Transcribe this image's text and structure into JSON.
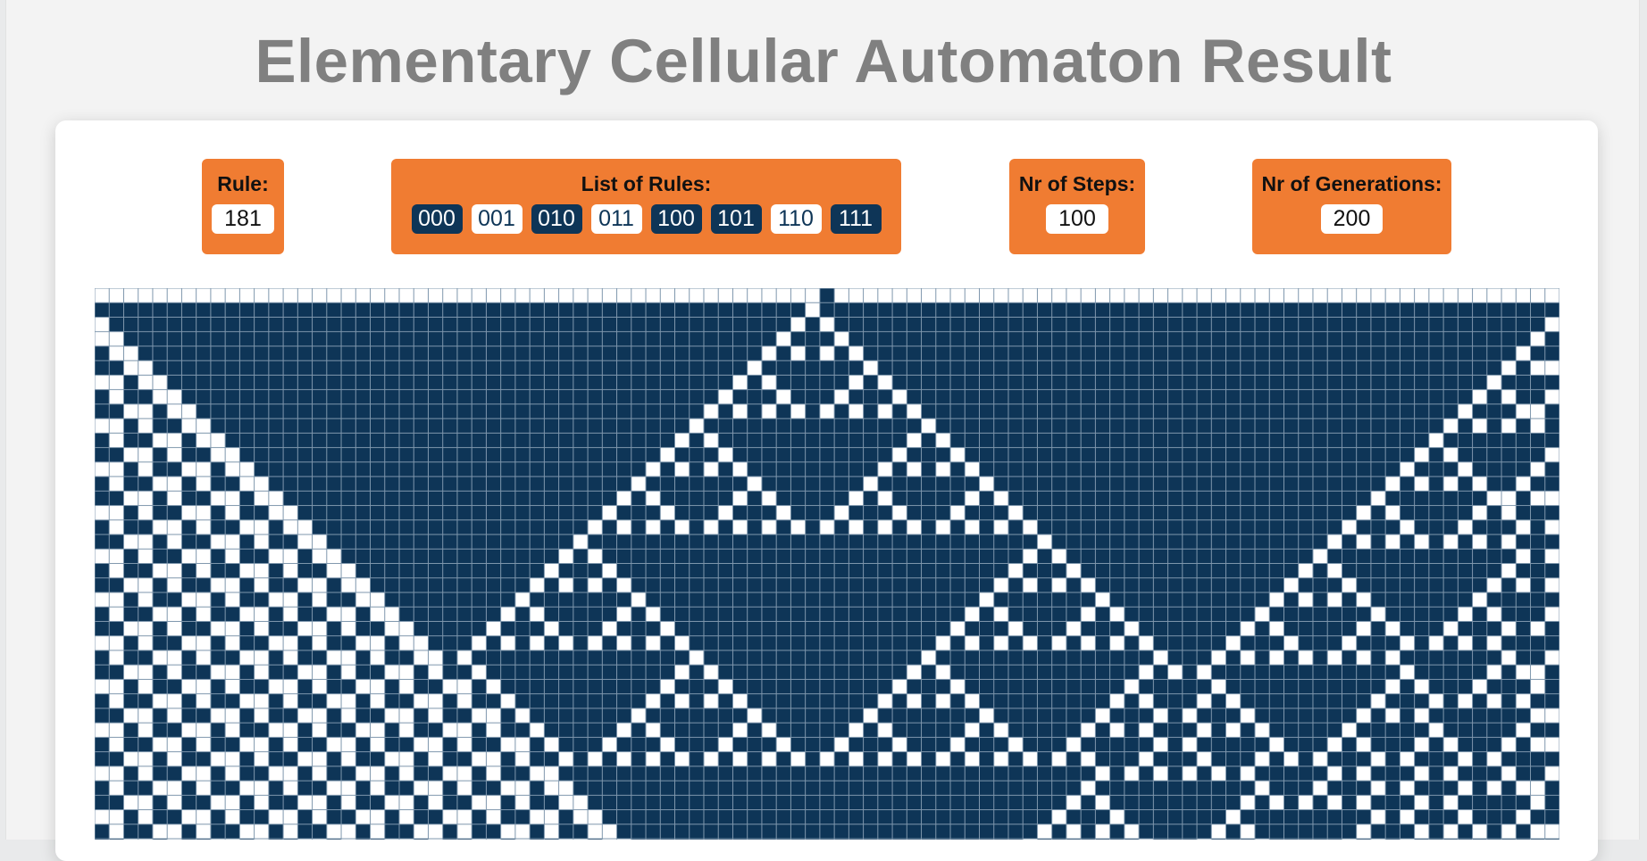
{
  "title": "Elementary Cellular Automaton Result",
  "rule": {
    "label": "Rule:",
    "value": "181"
  },
  "rule_list": {
    "label": "List of Rules:",
    "items": [
      {
        "pattern": "000",
        "active": true
      },
      {
        "pattern": "001",
        "active": false
      },
      {
        "pattern": "010",
        "active": true
      },
      {
        "pattern": "011",
        "active": false
      },
      {
        "pattern": "100",
        "active": true
      },
      {
        "pattern": "101",
        "active": true
      },
      {
        "pattern": "110",
        "active": false
      },
      {
        "pattern": "111",
        "active": true
      }
    ]
  },
  "steps": {
    "label": "Nr of Steps:",
    "value": "100"
  },
  "generations": {
    "label": "Nr of Generations:",
    "value": "200"
  },
  "colors": {
    "accent": "#f07c32",
    "cell_on": "#0e3557",
    "cell_off": "#ffffff",
    "title": "#808080"
  }
}
